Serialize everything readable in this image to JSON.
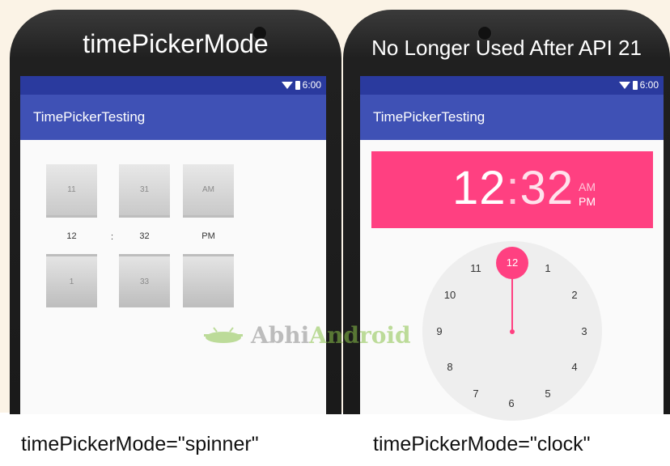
{
  "left_phone": {
    "title": "timePickerMode",
    "status_time": "6:00",
    "app_title": "TimePickerTesting",
    "spinner": {
      "top": [
        "11",
        "31",
        "AM"
      ],
      "selected": [
        "12",
        "32",
        "PM"
      ],
      "separator": ":",
      "bottom": [
        "1",
        "33",
        ""
      ]
    },
    "caption": "timePickerMode=\"spinner\""
  },
  "right_phone": {
    "title": "No Longer Used After API 21",
    "status_time": "6:00",
    "app_title": "TimePickerTesting",
    "clock": {
      "hour": "12",
      "separator": ":",
      "minute": "32",
      "am": "AM",
      "pm": "PM",
      "selected_hour": "12",
      "numbers": [
        "1",
        "2",
        "3",
        "4",
        "5",
        "6",
        "7",
        "8",
        "9",
        "10",
        "11"
      ]
    },
    "caption": "timePickerMode=\"clock\""
  },
  "watermark": {
    "part1": "Abhi",
    "part2": "Android"
  },
  "colors": {
    "status_bar": "#2a3a9e",
    "app_bar": "#3f51b5",
    "accent": "#ff4081"
  }
}
